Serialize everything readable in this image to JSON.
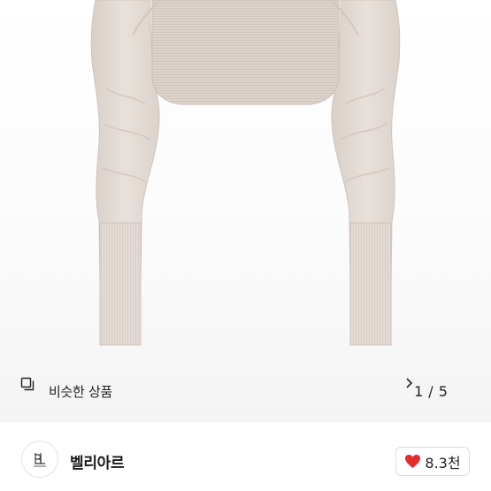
{
  "product_image": {
    "current_page": "1",
    "total_pages": "5",
    "separator": "/",
    "similar_items_label": "비슷한 상품",
    "garment_color": "#e6ddd7"
  },
  "icons": {
    "similar": "copy-icon",
    "next": "chevron-right-icon",
    "like": "heart-icon"
  },
  "shop": {
    "name": "벨리아르",
    "logo_text": "BL",
    "like_count": "8.3천",
    "like_color": "#e32d2d"
  }
}
